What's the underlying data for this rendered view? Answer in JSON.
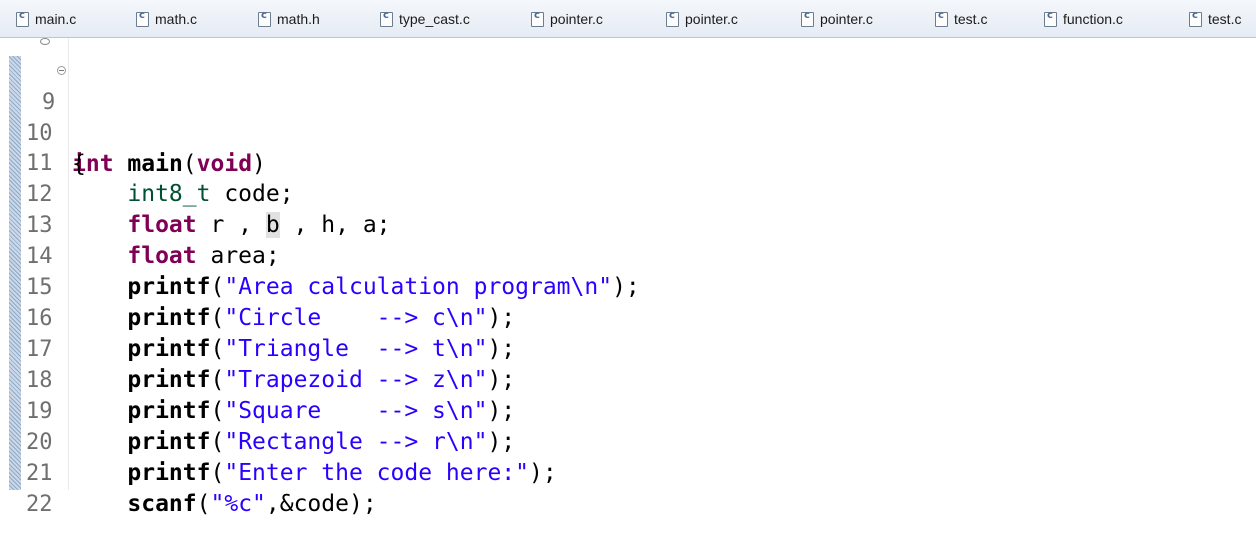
{
  "tabs": [
    "main.c",
    "math.c",
    "math.h",
    "type_cast.c",
    "pointer.c",
    "pointer.c",
    "pointer.c",
    "test.c",
    "function.c",
    "test.c"
  ],
  "editor": {
    "line_numbers": [
      "9",
      "10",
      "11",
      "12",
      "13",
      "14",
      "15",
      "16",
      "17",
      "18",
      "19",
      "20",
      "21",
      "22"
    ],
    "l9": {
      "kw_int": "int",
      "fn": "main",
      "open": "(",
      "kw_void": "void",
      "close": ")"
    },
    "l10": {
      "text": "{"
    },
    "l11": {
      "indent": "    ",
      "type": "int8_t",
      "rest": " code;"
    },
    "l12": {
      "indent": "    ",
      "kw": "float",
      "a1": " r , ",
      "b": "b",
      "a2": " , h, a;"
    },
    "l13": {
      "indent": "    ",
      "kw": "float",
      "rest": " area;"
    },
    "l14": {
      "indent": "    ",
      "fn": "printf",
      "open": "(",
      "str": "\"Area calculation program\\n\"",
      "close": ");"
    },
    "l15": {
      "indent": "    ",
      "fn": "printf",
      "open": "(",
      "str": "\"Circle    --> c\\n\"",
      "close": ");"
    },
    "l16": {
      "indent": "    ",
      "fn": "printf",
      "open": "(",
      "str": "\"Triangle  --> t\\n\"",
      "close": ");"
    },
    "l17": {
      "indent": "    ",
      "fn": "printf",
      "open": "(",
      "str": "\"Trapezoid --> z\\n\"",
      "close": ");"
    },
    "l18": {
      "indent": "    ",
      "fn": "printf",
      "open": "(",
      "str": "\"Square    --> s\\n\"",
      "close": ");"
    },
    "l19": {
      "indent": "    ",
      "fn": "printf",
      "open": "(",
      "str": "\"Rectangle --> r\\n\"",
      "close": ");"
    },
    "l20": {
      "indent": "    ",
      "fn": "printf",
      "open": "(",
      "str": "\"Enter the code here:\"",
      "close": ");"
    },
    "l21": {
      "indent": "    ",
      "fn": "scanf",
      "open": "(",
      "str": "\"%c\"",
      "close": ",&code);"
    }
  },
  "colors": {
    "keyword": "#7f0055",
    "string": "#2a00ff",
    "line_number": "#6f6f6f"
  }
}
